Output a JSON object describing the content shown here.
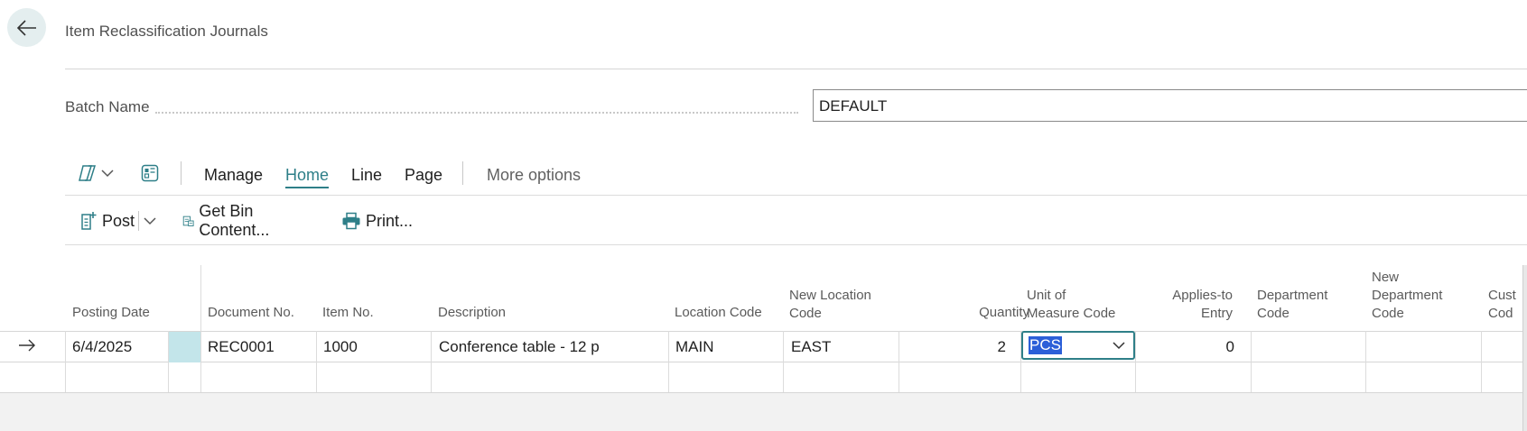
{
  "page": {
    "title": "Item Reclassification Journals"
  },
  "batch": {
    "label": "Batch Name",
    "value": "DEFAULT"
  },
  "tabs": {
    "manage": "Manage",
    "home": "Home",
    "line": "Line",
    "page": "Page",
    "more": "More options",
    "active": "Home"
  },
  "actions": {
    "post": "Post",
    "get_bin_content": "Get Bin Content...",
    "print": "Print..."
  },
  "grid": {
    "headers": {
      "posting_date": "Posting Date",
      "document_no": "Document No.",
      "item_no": "Item No.",
      "description": "Description",
      "location_code": "Location Code",
      "new_location_code_1": "New Location",
      "new_location_code_2": "Code",
      "quantity": "Quantity",
      "uom_1": "Unit of",
      "uom_2": "Measure Code",
      "applies_to_1": "Applies-to",
      "applies_to_2": "Entry",
      "department_1": "Department",
      "department_2": "Code",
      "new_dept_1": "New",
      "new_dept_2": "Department",
      "new_dept_3": "Code",
      "cust_1": "Cust",
      "cust_2": "Cod"
    },
    "row": {
      "posting_date": "6/4/2025",
      "document_no": "REC0001",
      "item_no": "1000",
      "description": "Conference table - 12 p",
      "location_code": "MAIN",
      "new_location_code": "EAST",
      "quantity": "2",
      "uom": "PCS",
      "applies_to_entry": "0"
    }
  },
  "colors": {
    "accent": "#2e7f88",
    "selection": "#2b5fd8",
    "cell_highlight": "#c3e5ea"
  }
}
